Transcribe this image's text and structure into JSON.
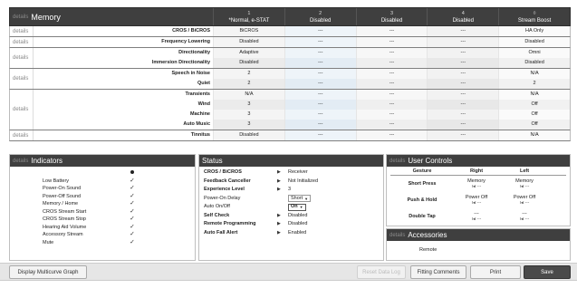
{
  "memory": {
    "details_label": "details",
    "title": "Memory",
    "columns": [
      {
        "num": "1",
        "name": "*Normal, e-STAT"
      },
      {
        "num": "2",
        "name": "Disabled"
      },
      {
        "num": "3",
        "name": "Disabled"
      },
      {
        "num": "4",
        "name": "Disabled"
      },
      {
        "num": "◊",
        "name": "Stream Boost"
      }
    ],
    "groups": [
      {
        "details": "details",
        "rows": [
          {
            "label": "CROS / BiCROS",
            "values": [
              "BiCROS",
              "---",
              "---",
              "---",
              "HA Only"
            ]
          }
        ]
      },
      {
        "details": "details",
        "rows": [
          {
            "label": "Frequency Lowering",
            "values": [
              "Disabled",
              "---",
              "---",
              "---",
              "Disabled"
            ]
          }
        ]
      },
      {
        "details": "details",
        "rows": [
          {
            "label": "Directionality",
            "values": [
              "Adaptive",
              "---",
              "---",
              "---",
              "Omni"
            ]
          },
          {
            "label": "Immersion Directionality",
            "values": [
              "Disabled",
              "---",
              "---",
              "---",
              "Disabled"
            ]
          }
        ]
      },
      {
        "details": "details",
        "rows": [
          {
            "label": "Speech in Noise",
            "values": [
              "2",
              "---",
              "---",
              "---",
              "N/A"
            ]
          },
          {
            "label": "Quiet",
            "values": [
              "2",
              "---",
              "---",
              "---",
              "2"
            ]
          }
        ]
      },
      {
        "details": "details",
        "rows": [
          {
            "label": "Transients",
            "values": [
              "N/A",
              "---",
              "---",
              "---",
              "N/A"
            ]
          },
          {
            "label": "Wind",
            "values": [
              "3",
              "---",
              "---",
              "---",
              "Off"
            ]
          },
          {
            "label": "Machine",
            "values": [
              "3",
              "---",
              "---",
              "---",
              "Off"
            ]
          },
          {
            "label": "Auto Music",
            "values": [
              "3",
              "---",
              "---",
              "---",
              "Off"
            ]
          }
        ]
      },
      {
        "details": "details",
        "rows": [
          {
            "label": "Tinnitus",
            "values": [
              "Disabled",
              "---",
              "---",
              "---",
              "N/A"
            ]
          }
        ]
      }
    ]
  },
  "indicators": {
    "details_label": "details",
    "title": "Indicators",
    "rows": [
      {
        "label": "",
        "mark": "dot"
      },
      {
        "label": "Low Battery",
        "mark": "✓"
      },
      {
        "label": "Power-On Sound",
        "mark": "✓"
      },
      {
        "label": "Power-Off Sound",
        "mark": "✓"
      },
      {
        "label": "Memory / Home",
        "mark": "✓"
      },
      {
        "label": "CROS Stream Start",
        "mark": "✓"
      },
      {
        "label": "CROS Stream Stop",
        "mark": "✓"
      },
      {
        "label": "Hearing Aid Volume",
        "mark": "✓"
      },
      {
        "label": "Accessory Stream",
        "mark": "✓"
      },
      {
        "label": "Mute",
        "mark": "✓"
      }
    ]
  },
  "status": {
    "title": "Status",
    "rows": [
      {
        "label": "CROS / BiCROS",
        "bold": true,
        "arrow": "▶",
        "value": "Receiver",
        "type": "text"
      },
      {
        "label": "Feedback Canceller",
        "bold": true,
        "arrow": "▶",
        "value": "Not Initialized",
        "type": "text"
      },
      {
        "label": "Experience Level",
        "bold": true,
        "arrow": "▶",
        "value": "3",
        "type": "text"
      },
      {
        "label": "Power-On Delay",
        "bold": false,
        "arrow": "",
        "value": "Short",
        "type": "select"
      },
      {
        "label": "Auto On/Off",
        "bold": false,
        "arrow": "",
        "value": "On",
        "type": "select-bold"
      },
      {
        "label": "Self Check",
        "bold": true,
        "arrow": "▶",
        "value": "Disabled",
        "type": "text"
      },
      {
        "label": "Remote Programming",
        "bold": true,
        "arrow": "▶",
        "value": "Disabled",
        "type": "text"
      },
      {
        "label": "Auto Fall Alert",
        "bold": true,
        "arrow": "▶",
        "value": "Enabled",
        "type": "text"
      }
    ]
  },
  "user_controls": {
    "details_label": "details",
    "title": "User Controls",
    "headers": {
      "gesture": "Gesture",
      "right": "Right",
      "left": "Left"
    },
    "rows": [
      {
        "gesture": "Short Press",
        "right": "Memory",
        "right_sub": "I◂I ---",
        "left": "Memory",
        "left_sub": "I◂I ---"
      },
      {
        "gesture": "Push & Hold",
        "right": "Power Off",
        "right_sub": "I◂I ---",
        "left": "Power Off",
        "left_sub": "I◂I ---"
      },
      {
        "gesture": "Double Tap",
        "right": "---",
        "right_sub": "I◂I ---",
        "left": "---",
        "left_sub": "I◂I ---"
      }
    ]
  },
  "accessories": {
    "details_label": "details",
    "title": "Accessories",
    "rows": [
      "Remote"
    ]
  },
  "bottom_bar": {
    "multicurve_label": "Display Multicurve Graph",
    "reset_label": "Reset Data Log",
    "fitting_label": "Fitting Comments",
    "print_label": "Print",
    "save_label": "Save"
  }
}
